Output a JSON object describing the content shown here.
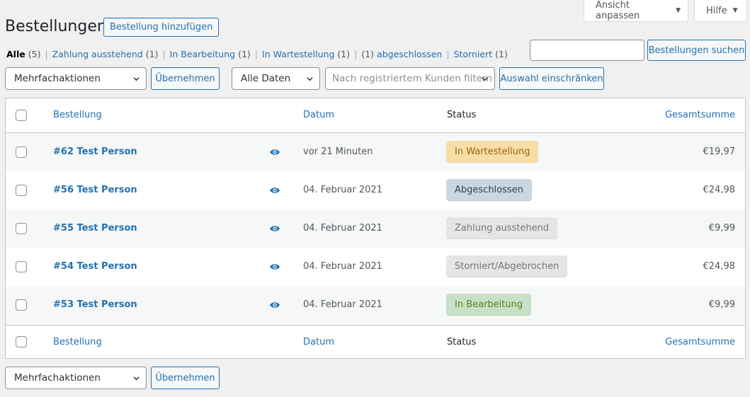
{
  "screen_meta": {
    "view_label": "Ansicht anpassen",
    "help_label": "Hilfe"
  },
  "page": {
    "title": "Bestellungen",
    "add_new_label": "Bestellung hinzufügen"
  },
  "status_filters": [
    {
      "label": "Alle",
      "count": "(5)",
      "current": true
    },
    {
      "label": "Zahlung ausstehend",
      "count": "(1)"
    },
    {
      "label": "In Bearbeitung",
      "count": "(1)"
    },
    {
      "label": "In Wartestellung",
      "count": "(1)"
    },
    {
      "prefix": "(1)",
      "label": "abgeschlossen"
    },
    {
      "label": "Storniert",
      "count": "(1)"
    }
  ],
  "search": {
    "value": "",
    "button_label": "Bestellungen suchen"
  },
  "filters": {
    "bulk_actions": "Mehrfachaktionen",
    "apply_label": "Übernehmen",
    "dates": "Alle Daten",
    "customer_placeholder": "Nach registriertem Kunden filtern",
    "filter_button": "Auswahl einschränken"
  },
  "table": {
    "columns": {
      "order": "Bestellung",
      "date": "Datum",
      "status": "Status",
      "total": "Gesamtsumme"
    },
    "rows": [
      {
        "order": "#62 Test Person",
        "date": "vor 21 Minuten",
        "status": "In Wartestellung",
        "status_key": "on-hold",
        "total": "€19,97"
      },
      {
        "order": "#56 Test Person",
        "date": "04. Februar 2021",
        "status": "Abgeschlossen",
        "status_key": "completed",
        "total": "€24,98"
      },
      {
        "order": "#55 Test Person",
        "date": "04. Februar 2021",
        "status": "Zahlung ausstehend",
        "status_key": "pending",
        "total": "€9,99"
      },
      {
        "order": "#54 Test Person",
        "date": "04. Februar 2021",
        "status": "Storniert/Abgebrochen",
        "status_key": "cancelled",
        "total": "€24,98"
      },
      {
        "order": "#53 Test Person",
        "date": "04. Februar 2021",
        "status": "In Bearbeitung",
        "status_key": "processing",
        "total": "€9,99"
      }
    ]
  },
  "icons": {
    "preview": "eye-icon",
    "dropdown": "chevron-down-icon",
    "menu": "caret-down-icon"
  },
  "colors": {
    "link": "#2271b1",
    "on_hold": "#f8dda7",
    "completed": "#c8d7e1",
    "pending": "#e5e5e5",
    "processing": "#c6e1c6"
  }
}
